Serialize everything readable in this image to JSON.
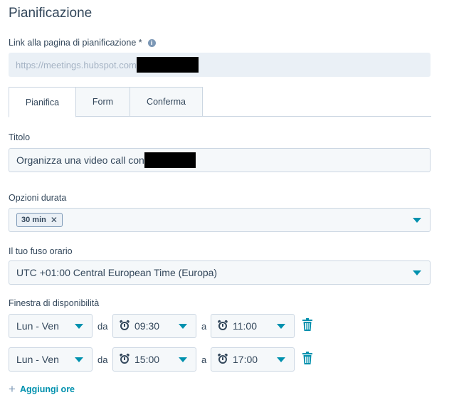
{
  "page_title": "Pianificazione",
  "link": {
    "label": "Link alla pagina di pianificazione *",
    "value": "https://meetings.hubspot.com",
    "redacted": true
  },
  "tabs": [
    {
      "label": "Pianifica",
      "active": true
    },
    {
      "label": "Form",
      "active": false
    },
    {
      "label": "Conferma",
      "active": false
    }
  ],
  "title_field": {
    "label": "Titolo",
    "value": "Organizza una video call con",
    "redacted": true
  },
  "duration": {
    "label": "Opzioni durata",
    "chips": [
      "30 min"
    ]
  },
  "timezone": {
    "label": "Il tuo fuso orario",
    "value": "UTC +01:00 Central European Time (Europa)"
  },
  "availability": {
    "label": "Finestra di disponibilità",
    "from_label": "da",
    "to_label": "a",
    "rows": [
      {
        "days": "Lun - Ven",
        "from": "09:30",
        "to": "11:00"
      },
      {
        "days": "Lun - Ven",
        "from": "15:00",
        "to": "17:00"
      }
    ]
  },
  "add_hours": {
    "icon": "+",
    "label": "Aggiungi ore"
  },
  "colors": {
    "accent": "#0091ae",
    "text": "#33475b",
    "field_bg": "#f5f8fa",
    "border": "#cbd6e2"
  }
}
